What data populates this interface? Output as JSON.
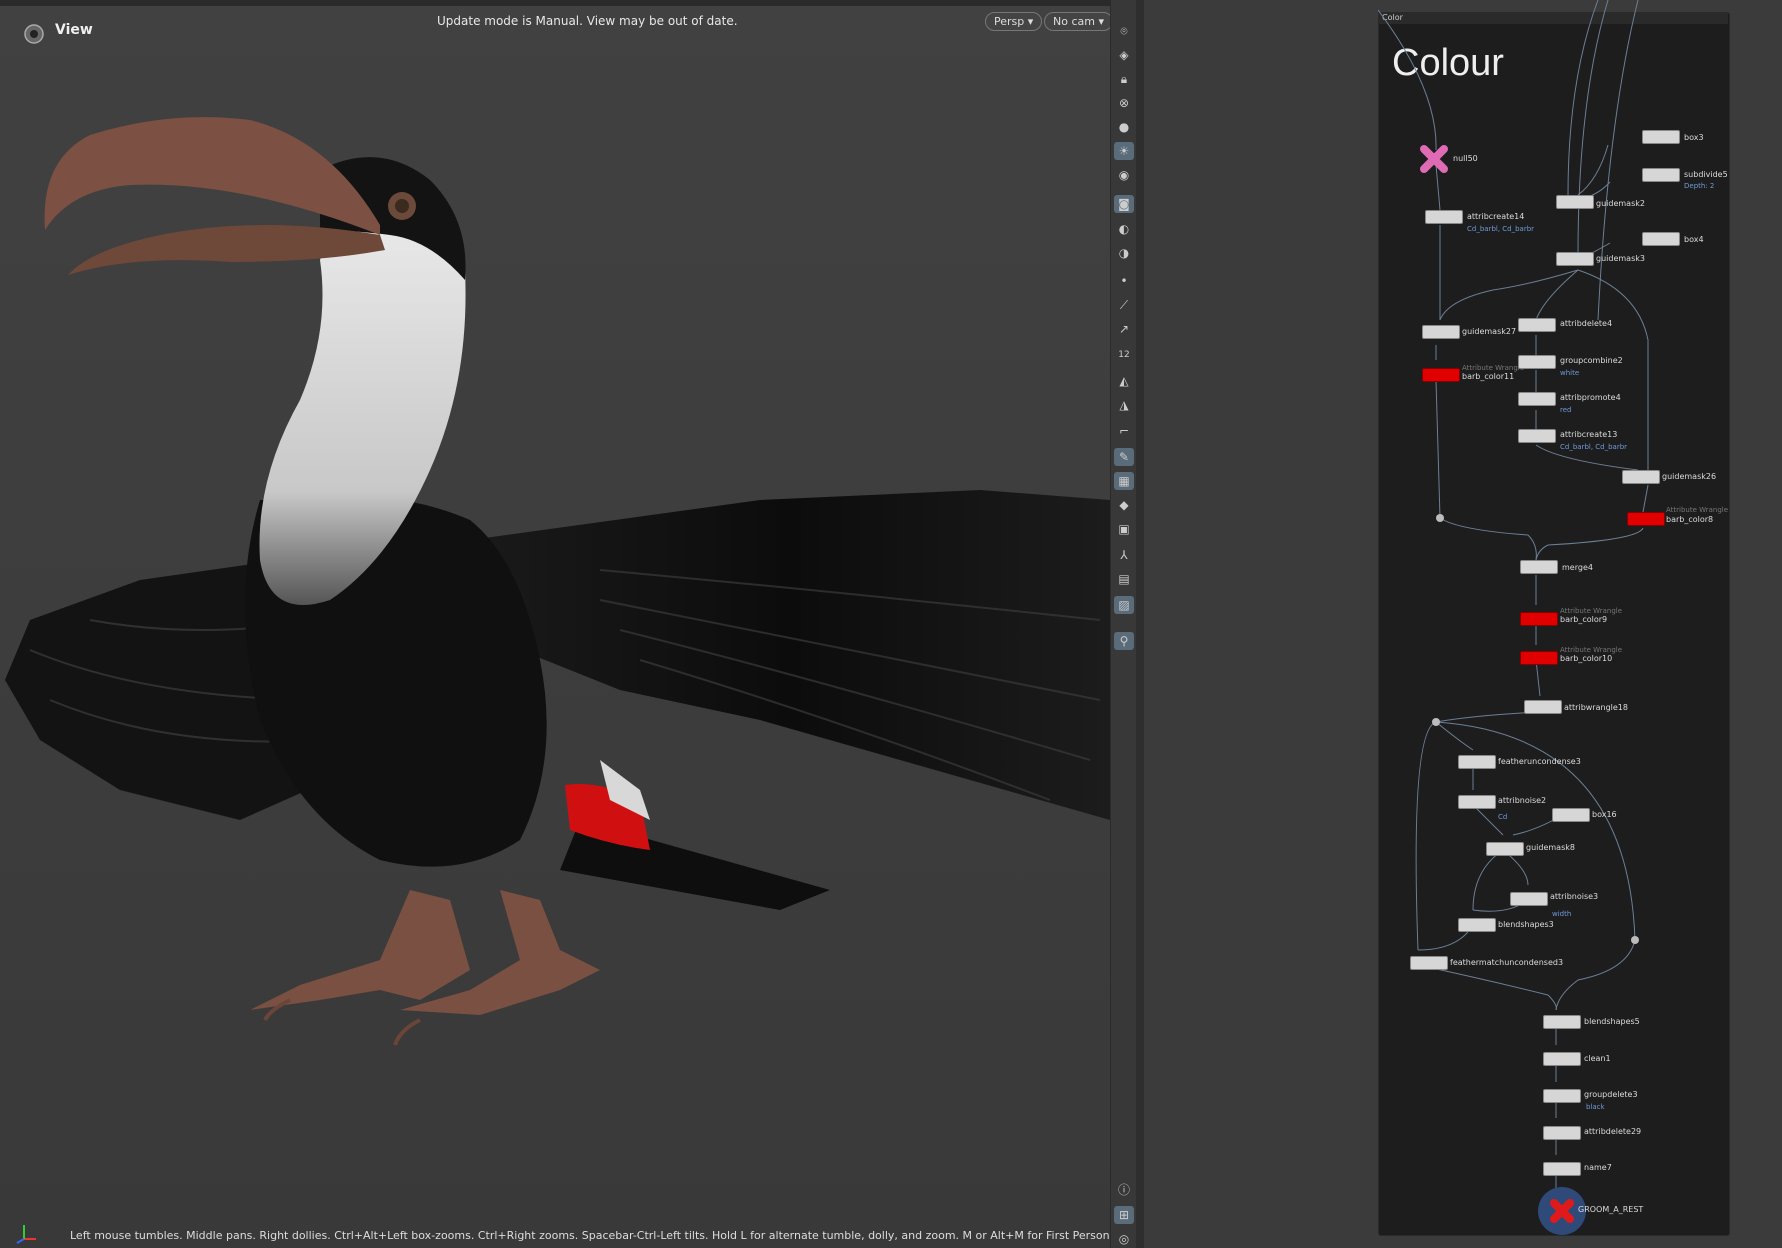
{
  "viewport": {
    "title": "View",
    "update_message": "Update mode is Manual. View may be out of date.",
    "camera_mode": "Persp ▾",
    "camera": "No cam ▾",
    "help_text": "Left mouse tumbles. Middle pans. Right dollies. Ctrl+Alt+Left box-zooms. Ctrl+Right zooms. Spacebar-Ctrl-Left tilts. Hold L for alternate tumble, dolly, and zoom. M or Alt+M for First Person Navigation."
  },
  "network": {
    "box_header": "Color",
    "title": "Colour",
    "nodes": [
      {
        "name": "null50",
        "type": "null"
      },
      {
        "name": "attribcreate14",
        "sub": "Cd_barbl, Cd_barbr"
      },
      {
        "name": "box3"
      },
      {
        "name": "subdivide5",
        "sub": "Depth: 2"
      },
      {
        "name": "guidemask2"
      },
      {
        "name": "box4"
      },
      {
        "name": "guidemask3"
      },
      {
        "name": "guidemask27"
      },
      {
        "name": "attribdelete4"
      },
      {
        "name": "barb_color11",
        "hint": "Attribute Wrangle"
      },
      {
        "name": "groupcombine2",
        "sub": "white"
      },
      {
        "name": "attribpromote4",
        "sub": "red"
      },
      {
        "name": "attribcreate13",
        "sub": "Cd_barbl, Cd_barbr"
      },
      {
        "name": "guidemask26"
      },
      {
        "name": "barb_color8",
        "hint": "Attribute Wrangle"
      },
      {
        "name": "merge4"
      },
      {
        "name": "barb_color9",
        "hint": "Attribute Wrangle"
      },
      {
        "name": "barb_color10",
        "hint": "Attribute Wrangle"
      },
      {
        "name": "attribwrangle18"
      },
      {
        "name": "featheruncondense3"
      },
      {
        "name": "attribnoise2",
        "sub": "Cd"
      },
      {
        "name": "box16"
      },
      {
        "name": "guidemask8"
      },
      {
        "name": "attribnoise3",
        "sub": "width"
      },
      {
        "name": "blendshapes3"
      },
      {
        "name": "feathermatchuncondensed3"
      },
      {
        "name": "blendshapes5"
      },
      {
        "name": "clean1"
      },
      {
        "name": "groupdelete3",
        "sub": "black"
      },
      {
        "name": "attribdelete29"
      },
      {
        "name": "name7"
      },
      {
        "name": "GROOM_A_REST",
        "type": "output"
      }
    ]
  },
  "toolbar": {
    "icons": [
      "display-options-icon",
      "ghost-icon",
      "lock-icon",
      "close-icon",
      "shading-icon",
      "light-icon",
      "headlight-icon",
      "camera-icon",
      "visibility-icon",
      "snapshot-icon",
      "point-icon",
      "vertex-icon",
      "normal-icon",
      "number-icon",
      "brush-icon",
      "paint-icon",
      "ruler-icon",
      "sculpt-icon",
      "texture-icon",
      "layers-icon",
      "map-icon",
      "skeleton-icon",
      "display-icon",
      "render-icon",
      "pin-icon",
      "info-icon",
      "grid-icon",
      "eye-icon"
    ],
    "number_label": "12"
  }
}
